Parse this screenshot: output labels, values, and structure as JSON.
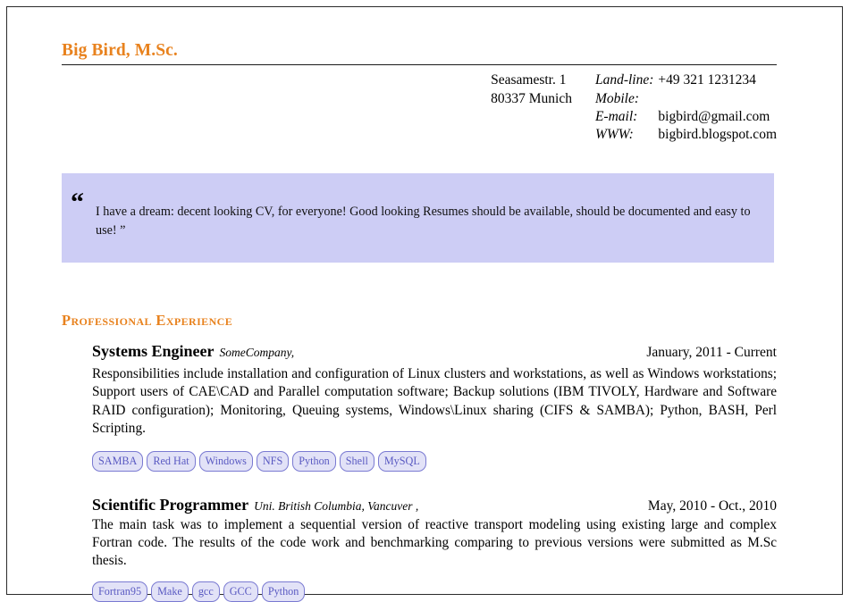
{
  "header": {
    "name": "Big Bird, M.Sc.",
    "accent_color": "#E8821E"
  },
  "contact": {
    "address_line1": "Seasamestr. 1",
    "address_line2": "80337 Munich",
    "rows": [
      {
        "label": "Land-line:",
        "value": "+49 321 1231234"
      },
      {
        "label": "Mobile:",
        "value": ""
      },
      {
        "label": "E-mail:",
        "value": "bigbird@gmail.com"
      },
      {
        "label": "WWW:",
        "value": "bigbird.blogspot.com"
      }
    ]
  },
  "quote": {
    "open_mark": "“",
    "text": "I have a dream: decent looking CV, for everyone! Good looking Resumes should be available, should be documented and easy to use! ”",
    "background_color": "#cdcdf5"
  },
  "sections": [
    {
      "heading": "Professional Experience",
      "entries": [
        {
          "title": "Systems Engineer",
          "organization": "SomeCompany,",
          "date": "January, 2011 - Current",
          "description": "Responsibilities include installation and configuration of Linux clusters and workstations, as well as Windows workstations; Support users of CAE\\CAD and Parallel computation software; Backup solutions (IBM TIVOLY, Hardware and Software RAID configuration); Monitoring, Queuing systems, Windows\\Linux sharing (CIFS & SAMBA); Python, BASH, Perl Scripting.",
          "tags": [
            "SAMBA",
            "Red Hat",
            "Windows",
            "NFS",
            "Python",
            "Shell",
            "MySQL"
          ]
        },
        {
          "title": "Scientific Programmer",
          "organization": "Uni. British Columbia, Vancuver ,",
          "date": "May, 2010 - Oct., 2010",
          "description": "The main task was to implement a sequential version of reactive transport modeling using existing large and complex Fortran code.  The results of the code work and benchmarking comparing to previous versions were submitted as M.Sc thesis.",
          "tags": [
            "Fortran95",
            "Make",
            "gcc",
            "GCC",
            "Python"
          ]
        }
      ]
    }
  ],
  "tag_style": {
    "border_color": "#7a7ad2",
    "fill_color": "#e2e2f7",
    "text_color": "#5a5ac2"
  }
}
